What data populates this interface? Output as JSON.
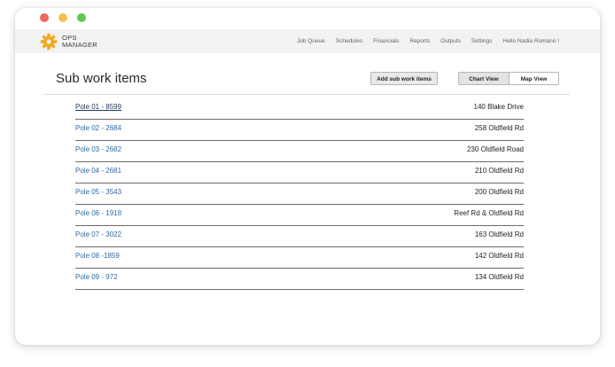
{
  "app": {
    "logo_line1": "OPS",
    "logo_line2": "MANAGER",
    "brand_color": "#f4a81d"
  },
  "nav": {
    "items": [
      {
        "label": "Job Queue"
      },
      {
        "label": "Schedules"
      },
      {
        "label": "Financials"
      },
      {
        "label": "Reports"
      },
      {
        "label": "Outputs"
      },
      {
        "label": "Settings"
      },
      {
        "label": "Hello Nadia Romano !"
      }
    ]
  },
  "page": {
    "title": "Sub work items",
    "add_button": "Add sub work items",
    "view_toggle": {
      "chart_label": "Chart View",
      "map_label": "Map View",
      "selected": "Chart View"
    }
  },
  "items": [
    {
      "name": "Pole 01 - 8599",
      "address": "140 Blake Drive",
      "active": true
    },
    {
      "name": "Pole 02 - 2684",
      "address": "258 Oldfield Rd",
      "active": false
    },
    {
      "name": "Pole 03 - 2682",
      "address": "230 Oldfield Road",
      "active": false
    },
    {
      "name": "Pole 04 - 2681",
      "address": "210 Oldfield Rd",
      "active": false
    },
    {
      "name": "Pole 05 - 3543",
      "address": "200 Oldfield Rd",
      "active": false
    },
    {
      "name": "Pole 06 - 1918",
      "address": "Reef Rd & Oldfield Rd",
      "active": false
    },
    {
      "name": "Pole 07 - 3022",
      "address": "163 Oldfield Rd",
      "active": false
    },
    {
      "name": "Pole 08 -1859",
      "address": "142 Oldfield Rd",
      "active": false
    },
    {
      "name": "Pole 09 - 972",
      "address": "134 Oldfield Rd",
      "active": false
    }
  ]
}
